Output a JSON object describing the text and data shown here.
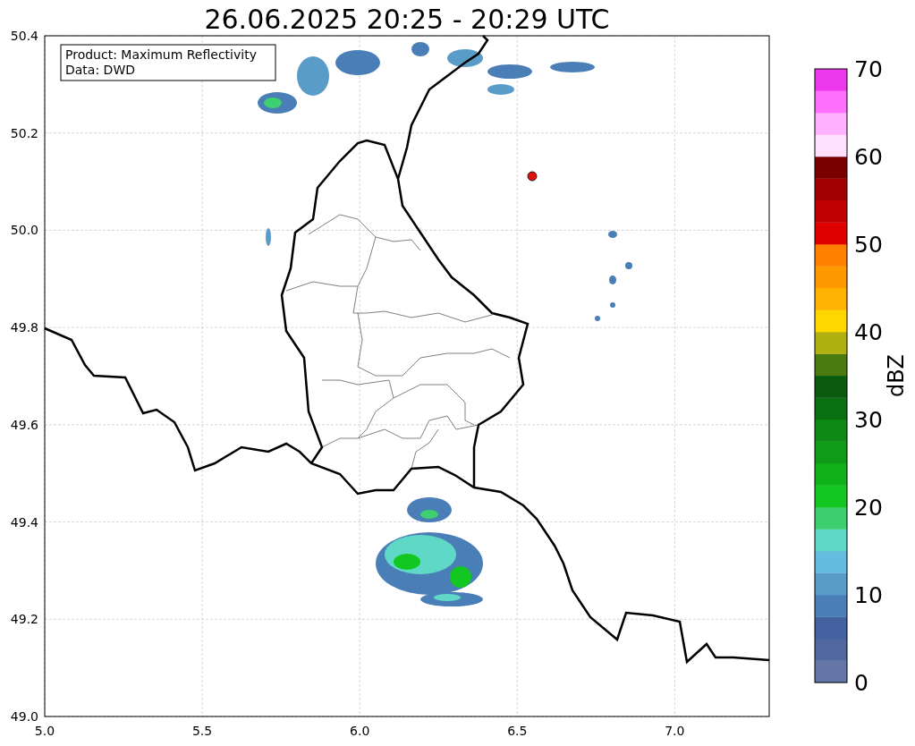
{
  "title": "26.06.2025 20:25 - 20:29 UTC",
  "info_box": {
    "lines": [
      "Product: Maximum Reflectivity",
      "Data: DWD"
    ]
  },
  "map": {
    "x_ticks": [
      "5.0",
      "5.5",
      "6.0",
      "6.5",
      "7.0"
    ],
    "y_ticks": [
      "50.4",
      "50.2",
      "50.0",
      "49.8",
      "49.6",
      "49.4",
      "49.2",
      "49.0"
    ]
  },
  "colorbar": {
    "label": "dBZ",
    "ticks": [
      "70",
      "60",
      "50",
      "40",
      "30",
      "20",
      "10",
      "0"
    ],
    "bands": [
      {
        "color": "#6476a8"
      },
      {
        "color": "#50689e"
      },
      {
        "color": "#4462a0"
      },
      {
        "color": "#4a7eb6"
      },
      {
        "color": "#5a9cc8"
      },
      {
        "color": "#64bce0"
      },
      {
        "color": "#60d8c8"
      },
      {
        "color": "#3ed070"
      },
      {
        "color": "#12c820"
      },
      {
        "color": "#10b21a"
      },
      {
        "color": "#0e9c18"
      },
      {
        "color": "#0d8a15"
      },
      {
        "color": "#0b7012"
      },
      {
        "color": "#0a5a10"
      },
      {
        "color": "#4a7a10"
      },
      {
        "color": "#b0b010"
      },
      {
        "color": "#ffd700"
      },
      {
        "color": "#ffb300"
      },
      {
        "color": "#ff9900"
      },
      {
        "color": "#ff8000"
      },
      {
        "color": "#e00000"
      },
      {
        "color": "#c00000"
      },
      {
        "color": "#a00000"
      },
      {
        "color": "#7a0000"
      },
      {
        "color": "#ffe0ff"
      },
      {
        "color": "#ffb0ff"
      },
      {
        "color": "#ff70ff"
      },
      {
        "color": "#ee38ee"
      }
    ]
  }
}
